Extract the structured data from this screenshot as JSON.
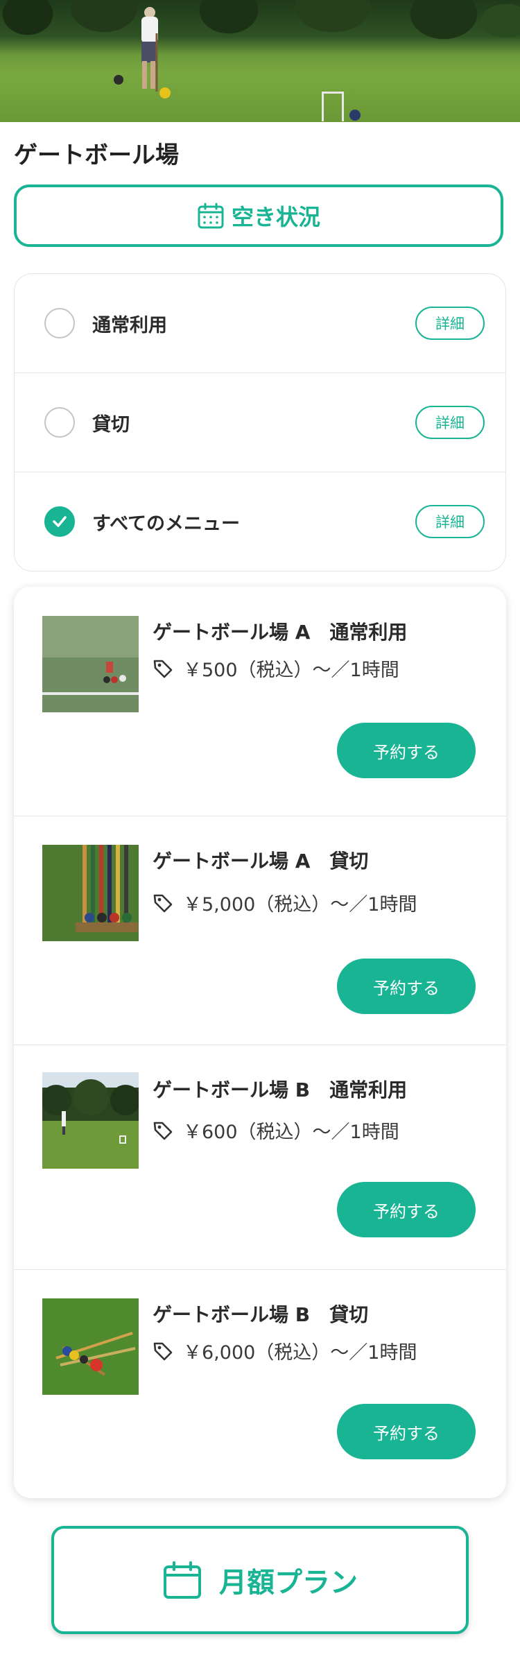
{
  "page": {
    "title": "ゲートボール場",
    "vacancy_button": "空き状況",
    "monthly_plan_button": "月額プラン"
  },
  "filters": [
    {
      "label": "通常利用",
      "detail": "詳細",
      "checked": false
    },
    {
      "label": "貸切",
      "detail": "詳細",
      "checked": false
    },
    {
      "label": "すべてのメニュー",
      "detail": "詳細",
      "checked": true
    }
  ],
  "menu_items": [
    {
      "name": "ゲートボール場 A　通常利用",
      "price": "￥500（税込）〜／1時間",
      "reserve": "予約する"
    },
    {
      "name": "ゲートボール場 A　貸切",
      "price": "￥5,000（税込）〜／1時間",
      "reserve": "予約する"
    },
    {
      "name": "ゲートボール場 B　通常利用",
      "price": "￥600（税込）〜／1時間",
      "reserve": "予約する"
    },
    {
      "name": "ゲートボール場 B　貸切",
      "price": "￥6,000（税込）〜／1時間",
      "reserve": "予約する"
    }
  ],
  "icons": {
    "vacancy": "calendar-icon",
    "price": "price-tag-icon",
    "monthly": "calendar-icon",
    "checked": "check-icon"
  },
  "colors": {
    "accent": "#18b493",
    "text": "#2a2a2a",
    "border": "#e4e4e4"
  }
}
